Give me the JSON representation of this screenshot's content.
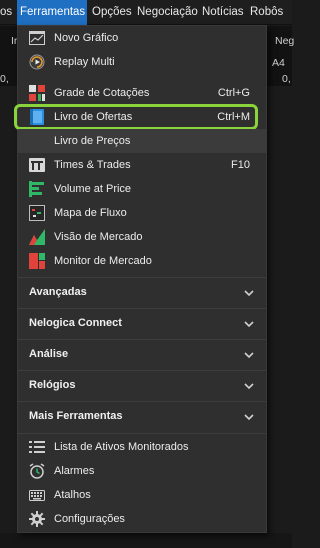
{
  "menubar": {
    "items": [
      {
        "label": "os"
      },
      {
        "label": "Ferramentas"
      },
      {
        "label": "Opções"
      },
      {
        "label": "Negociação"
      },
      {
        "label": "Notícias"
      },
      {
        "label": "Robôs"
      }
    ]
  },
  "background": {
    "cell_ir": "Ir",
    "cell_neg": "Neg",
    "cell_a4": "A4",
    "cell_zero_left": "0,",
    "cell_zero_right": "0,"
  },
  "dropdown": {
    "items": [
      {
        "label": "Novo Gráfico",
        "shortcut": "",
        "icon": "chart-window-icon"
      },
      {
        "label": "Replay Multi",
        "shortcut": "",
        "icon": "replay-icon"
      },
      {
        "label": "Grade de Cotações",
        "shortcut": "Ctrl+G",
        "icon": "quote-grid-icon"
      },
      {
        "label": "Livro de Ofertas",
        "shortcut": "Ctrl+M",
        "icon": "order-book-icon"
      },
      {
        "label": "Livro de Preços",
        "shortcut": "",
        "icon": ""
      },
      {
        "label": "Times & Trades",
        "shortcut": "F10",
        "icon": "times-trades-icon"
      },
      {
        "label": "Volume at Price",
        "shortcut": "",
        "icon": "volume-at-price-icon"
      },
      {
        "label": "Mapa de Fluxo",
        "shortcut": "",
        "icon": "flow-map-icon"
      },
      {
        "label": "Visão de Mercado",
        "shortcut": "",
        "icon": "market-view-icon"
      },
      {
        "label": "Monitor de Mercado",
        "shortcut": "",
        "icon": "market-monitor-icon"
      }
    ],
    "sections": [
      {
        "label": "Avançadas"
      },
      {
        "label": "Nelogica Connect"
      },
      {
        "label": "Análise"
      },
      {
        "label": "Relógios"
      },
      {
        "label": "Mais Ferramentas"
      }
    ],
    "bottom_items": [
      {
        "label": "Lista de Ativos Monitorados",
        "icon": "list-icon"
      },
      {
        "label": "Alarmes",
        "icon": "alarm-clock-icon"
      },
      {
        "label": "Atalhos",
        "icon": "keyboard-icon"
      },
      {
        "label": "Configurações",
        "icon": "gear-icon"
      }
    ]
  },
  "colors": {
    "active_menu": "#1f6fc2",
    "highlight_border": "#8ad33b",
    "menu_background": "#2f2f2f"
  }
}
